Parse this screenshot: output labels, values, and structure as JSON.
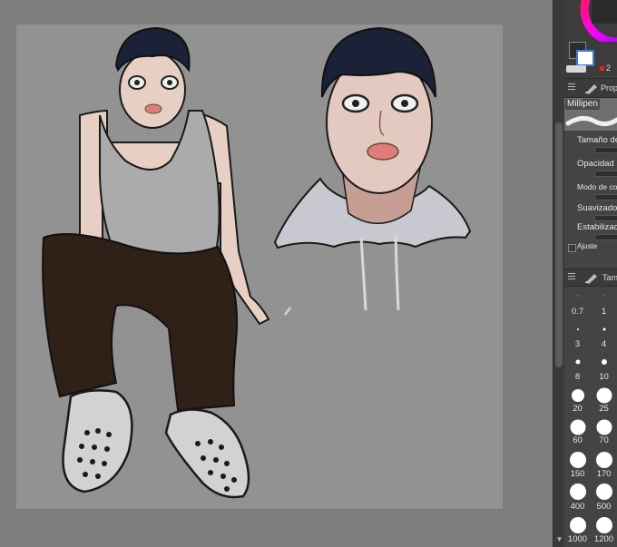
{
  "properties_panel": {
    "tab_label": "Prop",
    "brush_name": "Millipen",
    "rows": [
      {
        "label": "Tamaño de"
      },
      {
        "label": "Opacidad"
      },
      {
        "label": "Modo de com"
      },
      {
        "label": "Suavizado"
      },
      {
        "label": "Estabilizac"
      },
      {
        "label": "Ajuste"
      }
    ]
  },
  "color_panel": {
    "value_text": "2",
    "main_color": "#2c2c2c",
    "sub_color": "#ffffff"
  },
  "brush_size_panel": {
    "tab_label": "Tam",
    "sizes": [
      "0.7",
      "1",
      "3",
      "4",
      "8",
      "10",
      "20",
      "25",
      "60",
      "70",
      "150",
      "170",
      "400",
      "500",
      "1000",
      "1200"
    ]
  }
}
